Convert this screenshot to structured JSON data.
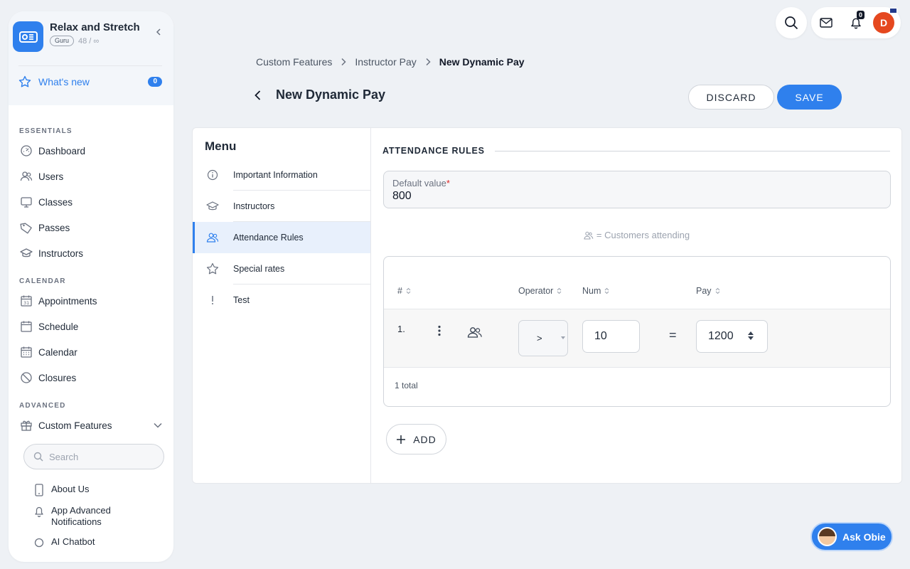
{
  "brand": {
    "name": "Relax and Stretch",
    "plan": "Guru",
    "count": "48 / ∞"
  },
  "whats_new": {
    "label": "What's new",
    "badge": "0"
  },
  "sidebar": {
    "essentials_title": "ESSENTIALS",
    "essentials": [
      {
        "label": "Dashboard",
        "icon": "dashboard-icon"
      },
      {
        "label": "Users",
        "icon": "users-icon"
      },
      {
        "label": "Classes",
        "icon": "classes-icon"
      },
      {
        "label": "Passes",
        "icon": "tag-icon"
      },
      {
        "label": "Instructors",
        "icon": "graduation-cap-icon"
      }
    ],
    "calendar_title": "CALENDAR",
    "calendar": [
      {
        "label": "Appointments",
        "icon": "calendar-31-icon"
      },
      {
        "label": "Schedule",
        "icon": "calendar-icon"
      },
      {
        "label": "Calendar",
        "icon": "calendar-grid-icon"
      },
      {
        "label": "Closures",
        "icon": "ban-icon"
      }
    ],
    "advanced_title": "ADVANCED",
    "custom_features": "Custom Features",
    "search_placeholder": "Search",
    "sub_items": [
      {
        "label": "About Us",
        "icon": "phone-icon"
      },
      {
        "label": "App Advanced Notifications",
        "icon": "bell-icon"
      },
      {
        "label": "AI Chatbot",
        "icon": "chat-icon"
      }
    ]
  },
  "topbar": {
    "notification_count": "0",
    "avatar_initial": "D"
  },
  "breadcrumb": {
    "items": [
      "Custom Features",
      "Instructor Pay"
    ],
    "current": "New Dynamic Pay"
  },
  "page": {
    "title": "New Dynamic Pay",
    "discard_label": "DISCARD",
    "save_label": "SAVE"
  },
  "menu": {
    "title": "Menu",
    "items": [
      {
        "label": "Important Information",
        "icon": "info-icon",
        "active": false
      },
      {
        "label": "Instructors",
        "icon": "graduation-cap-icon",
        "active": false
      },
      {
        "label": "Attendance Rules",
        "icon": "users-icon",
        "active": true
      },
      {
        "label": "Special rates",
        "icon": "star-icon",
        "active": false
      },
      {
        "label": "Test",
        "icon": "exclamation-icon",
        "active": false
      }
    ]
  },
  "attendance": {
    "section_title": "ATTENDANCE RULES",
    "default_label": "Default value",
    "default_value": "800",
    "legend": "= Customers attending",
    "columns": [
      "#",
      "Operator",
      "Num",
      "Pay"
    ],
    "rows": [
      {
        "index": "1.",
        "operator": ">",
        "num": "10",
        "pay": "1200"
      }
    ],
    "total": "1 total",
    "add_label": "ADD"
  },
  "assistant": {
    "label": "Ask Obie"
  },
  "colors": {
    "accent": "#2f80ed",
    "avatar": "#e5481f",
    "background": "#eef1f5"
  }
}
